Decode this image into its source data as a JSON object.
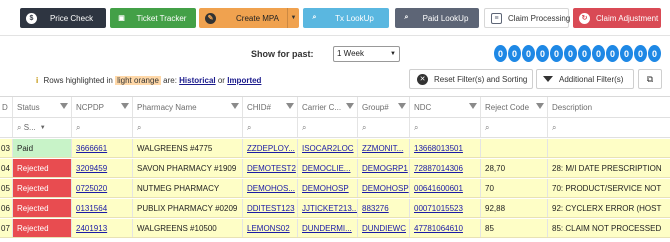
{
  "toolbar": {
    "price_check": {
      "label": "Price Check",
      "icon": "dollar-icon",
      "color": "#2e3541"
    },
    "ticket_tracker": {
      "label": "Ticket Tracker",
      "icon": "ticket-icon",
      "color": "#43a047"
    },
    "create_mpa": {
      "label": "Create MPA",
      "icon": "pencil-icon",
      "color": "#f0a24f"
    },
    "tx_lookup": {
      "label": "Tx LookUp",
      "icon": "search-icon",
      "color": "#5ab7e0"
    },
    "paid_lookup": {
      "label": "Paid LookUp",
      "icon": "search-icon",
      "color": "#5d6576"
    },
    "claim_processing": {
      "label": "Claim Processing",
      "icon": "document-icon",
      "color": "#ffffff"
    },
    "claim_adjustment": {
      "label": "Claim Adjustment",
      "icon": "adjust-icon",
      "color": "#d94a55"
    }
  },
  "period": {
    "label": "Show for past:",
    "selected": "1 Week"
  },
  "counter_digits": [
    "0",
    "0",
    "0",
    "0",
    "0",
    "0",
    "0",
    "0",
    "0",
    "0",
    "0",
    "0"
  ],
  "legend": {
    "prefix": "Rows highlighted in",
    "highlight_text": "light orange",
    "middle": "are:",
    "link1": "Historical",
    "or": "or",
    "link2": "Imported"
  },
  "buttons": {
    "reset": "Reset Filter(s) and Sorting",
    "additional": "Additional Filter(s)"
  },
  "columns": [
    "D",
    "Status",
    "NCPDP",
    "Pharmacy Name",
    "CHID#",
    "Carrier C...",
    "Group#",
    "NDC",
    "Reject Code",
    "Description"
  ],
  "status_filter_placeholder": "S...",
  "rows": [
    {
      "id": "03",
      "status": "Paid",
      "ncpdp": "3666661",
      "pharmacy": "WALGREENS #4775",
      "chid": "ZZDEPLOY...",
      "carrier": "ISOCAR2LOC",
      "group": "ZZMONIT...",
      "ndc": "13668013501",
      "reject": "",
      "description": ""
    },
    {
      "id": "04",
      "status": "Rejected",
      "ncpdp": "3209459",
      "pharmacy": "SAVON PHARMACY #1909",
      "chid": "DEMOTEST2",
      "carrier": "DEMOCLIE...",
      "group": "DEMOGRP1",
      "ndc": "72887014306",
      "reject": "28,70",
      "description": "28: M/I DATE PRESCRIPTION"
    },
    {
      "id": "05",
      "status": "Rejected",
      "ncpdp": "0725020",
      "pharmacy": "NUTMEG PHARMACY",
      "chid": "DEMOHOS...",
      "carrier": "DEMOHOSP",
      "group": "DEMOHOSP",
      "ndc": "00641600601",
      "reject": "70",
      "description": "70: PRODUCT/SERVICE NOT"
    },
    {
      "id": "06",
      "status": "Rejected",
      "ncpdp": "0131564",
      "pharmacy": "PUBLIX PHARMACY #0209",
      "chid": "DDITEST123",
      "carrier": "JJTICKET213...",
      "group": "883276",
      "ndc": "00071015523",
      "reject": "92,88",
      "description": "92: CYCLERX ERROR (HOST"
    },
    {
      "id": "07",
      "status": "Rejected",
      "ncpdp": "2401913",
      "pharmacy": "WALGREENS #10500",
      "chid": "LEMONS02",
      "carrier": "DUNDERMI...",
      "group": "DUNDIEWC",
      "ndc": "47781064610",
      "reject": "85",
      "description": "85: CLAIM NOT PROCESSED"
    }
  ]
}
